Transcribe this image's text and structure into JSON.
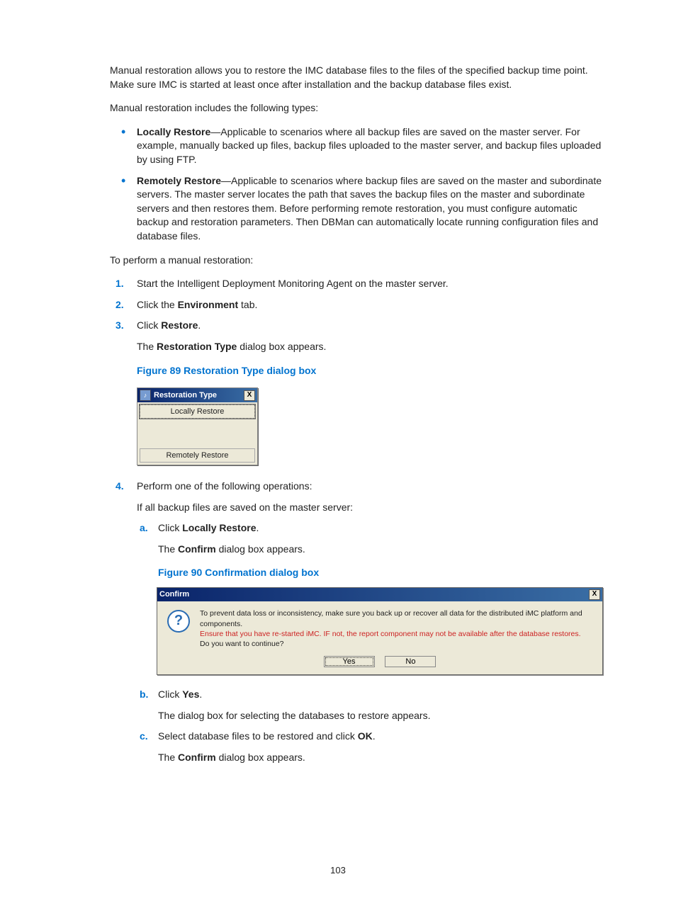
{
  "intro1": "Manual restoration allows you to restore the IMC database files to the files of the specified backup time point. Make sure IMC is started at least once after installation and the backup database files exist.",
  "intro2": "Manual restoration includes the following types:",
  "bullets": {
    "b0": {
      "term": "Locally Restore",
      "text": "—Applicable to scenarios where all backup files are saved on the master server. For example, manually backed up files, backup files uploaded to the master server, and backup files uploaded by using FTP."
    },
    "b1": {
      "term": "Remotely Restore",
      "text": "—Applicable to scenarios where backup files are saved on the master and subordinate servers. The master server locates the path that saves the backup files on the master and subordinate servers and then restores them. Before performing remote restoration, you must configure automatic backup and restoration parameters. Then DBMan can automatically locate running configuration files and database files."
    }
  },
  "toPerform": "To perform a manual restoration:",
  "steps": {
    "s1": {
      "num": "1.",
      "text": "Start the Intelligent Deployment Monitoring Agent on the master server."
    },
    "s2": {
      "num": "2.",
      "pre": "Click the ",
      "bold": "Environment",
      "post": " tab."
    },
    "s3": {
      "num": "3.",
      "pre": "Click ",
      "bold": "Restore",
      "post": ".",
      "after_pre": "The ",
      "after_bold": "Restoration Type",
      "after_post": " dialog box appears."
    },
    "s4": {
      "num": "4.",
      "text": "Perform one of the following operations:",
      "after": "If all backup files are saved on the master server:"
    }
  },
  "fig89": {
    "caption": "Figure 89 Restoration Type dialog box",
    "title": "Restoration Type",
    "icon_glyph": "♪",
    "btn1": "Locally Restore",
    "btn2": "Remotely Restore"
  },
  "sub": {
    "a": {
      "letter": "a.",
      "pre": "Click ",
      "bold": "Locally Restore",
      "post": ".",
      "after_pre": "The ",
      "after_bold": "Confirm",
      "after_post": " dialog box appears."
    },
    "b": {
      "letter": "b.",
      "pre": "Click ",
      "bold": "Yes",
      "post": ".",
      "after": "The dialog box for selecting the databases to restore appears."
    },
    "c": {
      "letter": "c.",
      "pre": "Select database files to be restored and click ",
      "bold": "OK",
      "post": ".",
      "after_pre": "The ",
      "after_bold": "Confirm",
      "after_post": " dialog box appears."
    }
  },
  "fig90": {
    "caption": "Figure 90 Confirmation dialog box",
    "title": "Confirm",
    "msg1": "To prevent data loss or inconsistency, make sure you back up or recover all data for the distributed iMC platform and components.",
    "msg_warn": "Ensure that you have re-started iMC. IF not, the report component may not be available after the database restores.",
    "msg2": "Do you want to continue?",
    "yes": "Yes",
    "no": "No"
  },
  "pageNum": "103"
}
